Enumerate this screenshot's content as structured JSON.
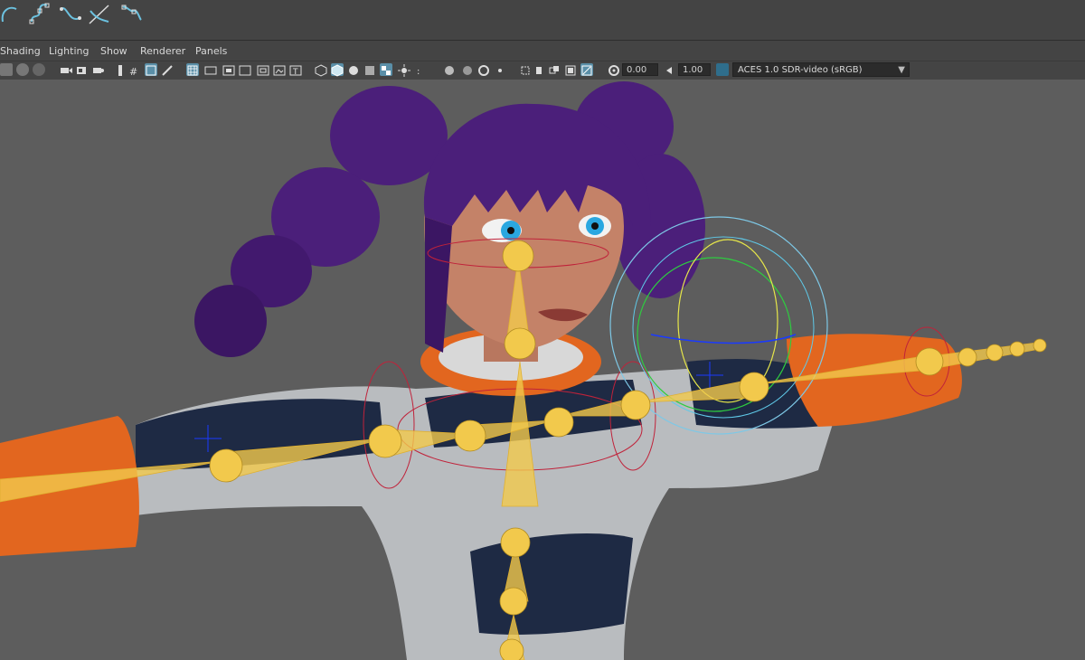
{
  "menubar": {
    "items": [
      "Shading",
      "Lighting",
      "Show",
      "Renderer",
      "Panels"
    ]
  },
  "toolbar": {
    "exposure_value": "0.00",
    "gamma_value": "1.00",
    "color_space": "ACES 1.0 SDR-video (sRGB)"
  },
  "shelf": {
    "icons": [
      "lasso-curve-icon",
      "cv-curve-icon",
      "ep-curve-icon",
      "bezier-curve-icon",
      "pencil-curve-icon"
    ]
  },
  "colors": {
    "ui_bg": "#444444",
    "viewport_bg": "#5d5d5d",
    "joint": "#f2c94c",
    "hair": "#4b1f7a",
    "suit_orange": "#e2661f",
    "suit_navy": "#1e2a44"
  }
}
